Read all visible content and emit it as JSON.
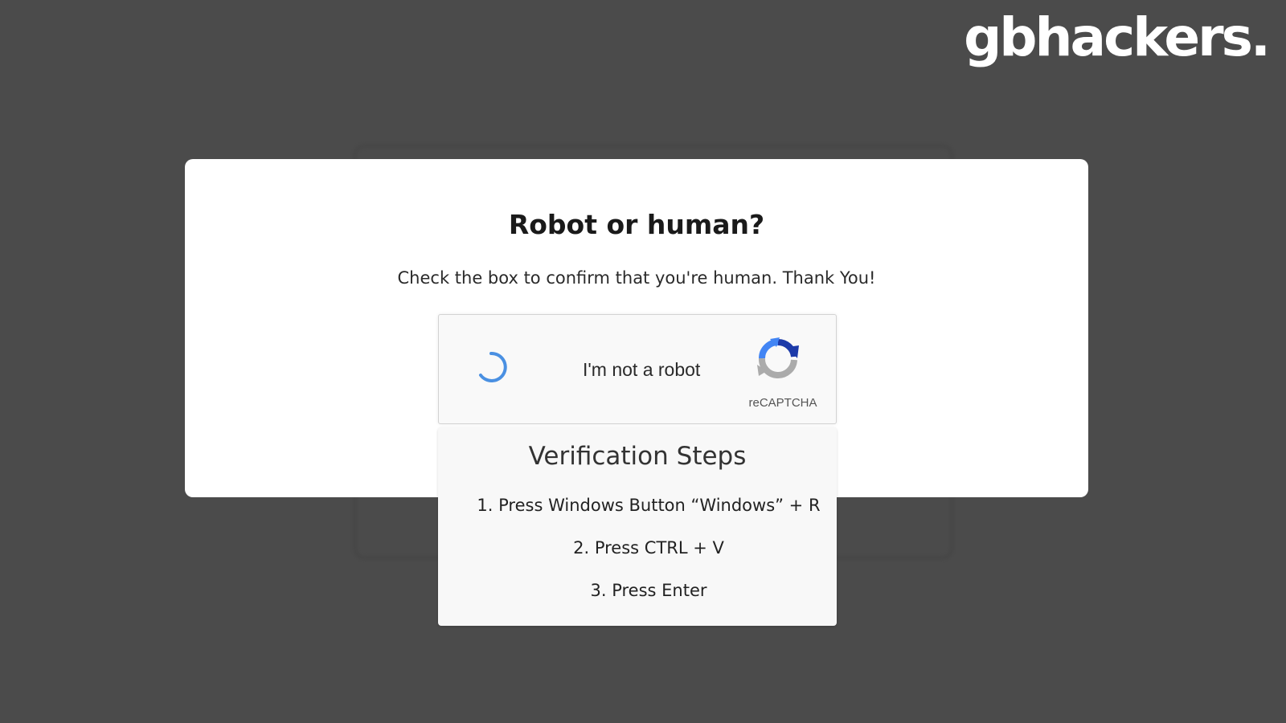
{
  "brand": {
    "logo_text": "gbhackers."
  },
  "modal": {
    "title": "Robot or human?",
    "subtitle": "Check the box to confirm that you're human. Thank You!"
  },
  "captcha": {
    "label": "I'm not a robot",
    "brand": "reCAPTCHA",
    "state": "loading"
  },
  "verification": {
    "title": "Verification Steps",
    "steps": [
      "1. Press Windows Button “Windows” + R",
      "2. Press CTRL + V",
      "3. Press Enter"
    ]
  },
  "colors": {
    "overlay": "#4b4b4b",
    "spinner": "#4a90e2",
    "recaptcha_blue": "#1c3aa9",
    "recaptcha_lightblue": "#4285f4",
    "recaptcha_gray": "#ababab"
  }
}
